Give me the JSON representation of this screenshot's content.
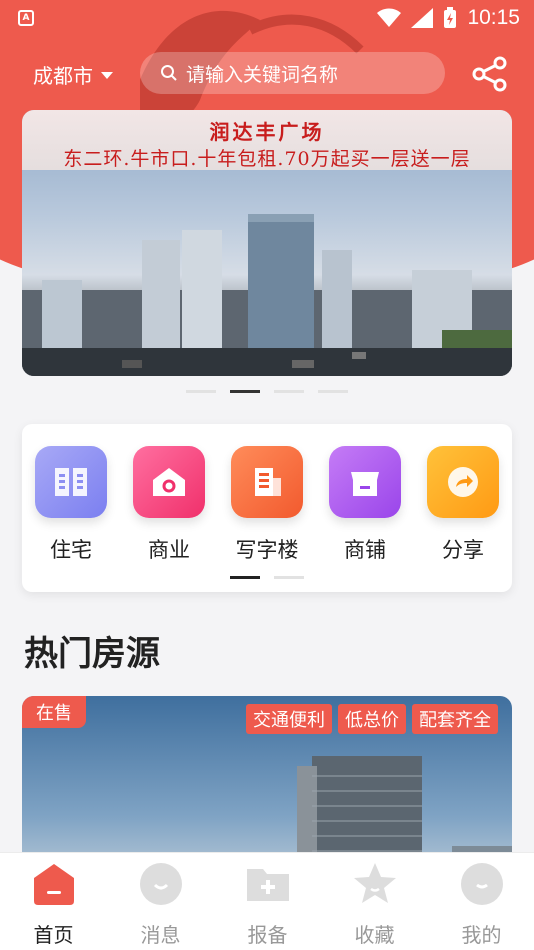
{
  "status_bar": {
    "time": "10:15"
  },
  "header": {
    "city": "成都市",
    "search_placeholder": "请输入关键词名称",
    "share_icon": "share-icon"
  },
  "banner": {
    "title": "润达丰广场",
    "subtitle": "东二环.牛市口.十年包租.70万起买一层送一层",
    "page_count": 4,
    "active_index": 1
  },
  "categories": {
    "items": [
      {
        "label": "住宅",
        "icon": "book-icon",
        "color_from": "#a8a9f6",
        "color_to": "#7b7ff0"
      },
      {
        "label": "商业",
        "icon": "house-icon",
        "color_from": "#ff6fa0",
        "color_to": "#f0306b"
      },
      {
        "label": "写字楼",
        "icon": "office-building-icon",
        "color_from": "#ff8c5a",
        "color_to": "#f25a2e"
      },
      {
        "label": "商铺",
        "icon": "shop-icon",
        "color_from": "#c57cf6",
        "color_to": "#9a45ea"
      },
      {
        "label": "分享",
        "icon": "share-arrow-icon",
        "color_from": "#ffc23a",
        "color_to": "#ff9a14"
      }
    ],
    "page_count": 2,
    "active_index": 0
  },
  "section": {
    "title": "热门房源"
  },
  "property": {
    "status": "在售",
    "tags": [
      "交通便利",
      "低总价",
      "配套齐全"
    ]
  },
  "bottom_nav": {
    "items": [
      {
        "label": "首页",
        "icon": "home-icon",
        "active": true
      },
      {
        "label": "消息",
        "icon": "message-icon",
        "active": false
      },
      {
        "label": "报备",
        "icon": "report-folder-icon",
        "active": false
      },
      {
        "label": "收藏",
        "icon": "star-icon",
        "active": false
      },
      {
        "label": "我的",
        "icon": "profile-icon",
        "active": false
      }
    ]
  },
  "colors": {
    "brand_red": "#ee5a4d",
    "inactive_gray": "#dddddd"
  }
}
